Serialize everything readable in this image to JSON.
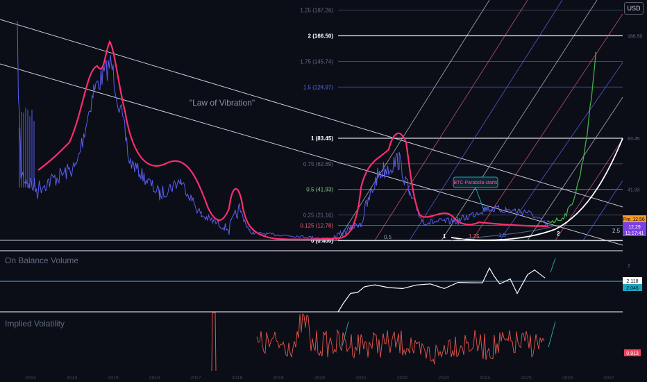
{
  "currency_button": "USD",
  "chart_data": [
    {
      "type": "line",
      "panel": "price",
      "annotation": "\"Law of Vibration\"",
      "callout": "BTC Parabola starts",
      "fib_levels": [
        {
          "ratio": "1.25",
          "label": "1.25 (187.26)",
          "price": 187.26,
          "color": "#5f6b82"
        },
        {
          "ratio": "2",
          "label": "2 (166.50)",
          "price": 166.5,
          "color": "#ffffff"
        },
        {
          "ratio": "1.75",
          "label": "1.75 (145.74)",
          "price": 145.74,
          "color": "#5f6b82"
        },
        {
          "ratio": "1.5",
          "label": "1.5 (124.97)",
          "price": 124.97,
          "color": "#5b6cf5"
        },
        {
          "ratio": "1",
          "label": "1 (83.45)",
          "price": 83.45,
          "color": "#ffffff"
        },
        {
          "ratio": "0.75",
          "label": "0.75 (62.69)",
          "price": 62.69,
          "color": "#5f6b82"
        },
        {
          "ratio": "0.5",
          "label": "0.5 (41.93)",
          "price": 41.93,
          "color": "#8bc78b"
        },
        {
          "ratio": "0.25",
          "label": "0.25 (21.16)",
          "price": 21.16,
          "color": "#5f6b82"
        },
        {
          "ratio": "0.125",
          "label": "0.125 (12.78)",
          "price": 12.78,
          "color": "#e0607a"
        },
        {
          "ratio": "0",
          "label": "0 (0.400)",
          "price": 0.4,
          "color": "#ffffff"
        }
      ],
      "arc_labels": [
        "0.5",
        "1",
        "1.25",
        "1.5",
        "2",
        "2.5"
      ],
      "price_tags": {
        "pre_label": "Pre",
        "pre_value": "12.56",
        "last_value": "12.29",
        "countdown": "11:17:41"
      },
      "visible_right_axis_ticks": [
        "166.50",
        "83.45",
        "41.93",
        "12.56"
      ],
      "x_ticks": [
        "2013",
        "2014",
        "2015",
        "2016",
        "2017",
        "2018",
        "2019",
        "2020",
        "2021",
        "2022",
        "2023",
        "2024",
        "2025",
        "2026",
        "2027"
      ]
    },
    {
      "type": "line",
      "panel": "obv",
      "title": "On Balance Volume",
      "value_tags": [
        "2.118",
        "2.046"
      ],
      "axis_ticks": [
        "2"
      ]
    },
    {
      "type": "line",
      "panel": "iv",
      "title": "Implied Volatility",
      "value_tags": [
        "0.913"
      ]
    }
  ]
}
